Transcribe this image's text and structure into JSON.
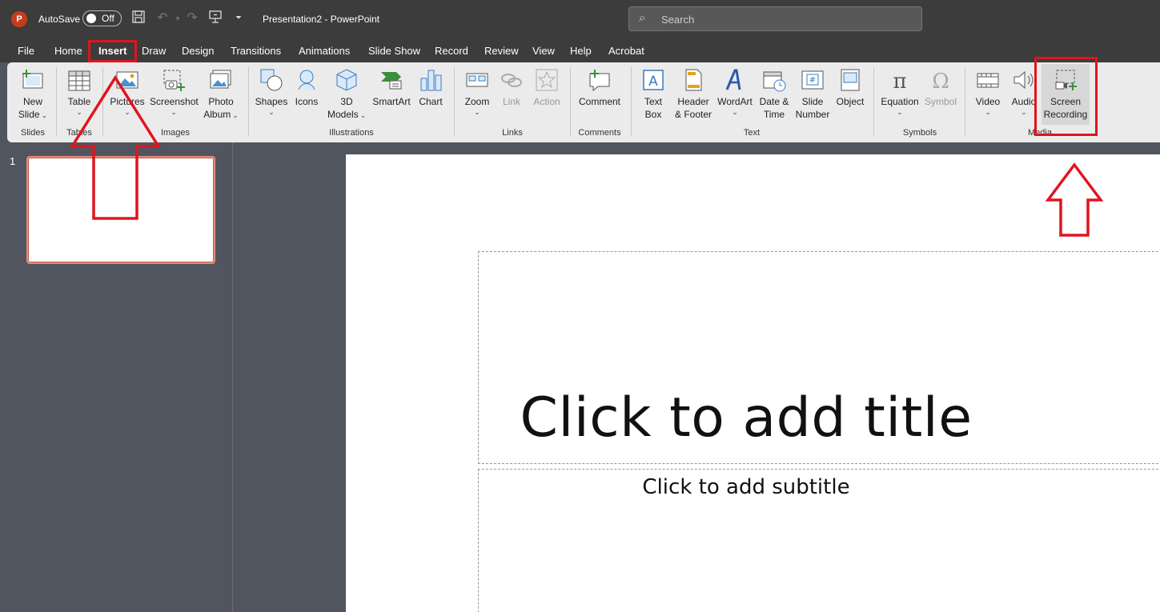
{
  "titlebar": {
    "logo_letter": "P",
    "autosave_label": "AutoSave",
    "autosave_state": "Off",
    "doc_title": "Presentation2  -  PowerPoint",
    "search_placeholder": "Search"
  },
  "menu": {
    "tabs": [
      "File",
      "Home",
      "Insert",
      "Draw",
      "Design",
      "Transitions",
      "Animations",
      "Slide Show",
      "Record",
      "Review",
      "View",
      "Help",
      "Acrobat"
    ],
    "active": "Insert"
  },
  "ribbon": {
    "buttons": {
      "new_slide": [
        "New",
        "Slide"
      ],
      "table": "Table",
      "pictures": "Pictures",
      "screenshot": "Screenshot",
      "photo_album": [
        "Photo",
        "Album"
      ],
      "shapes": "Shapes",
      "icons": "Icons",
      "models_3d": [
        "3D",
        "Models"
      ],
      "smartart": "SmartArt",
      "chart": "Chart",
      "zoom": "Zoom",
      "link": "Link",
      "action": "Action",
      "comment": "Comment",
      "text_box": [
        "Text",
        "Box"
      ],
      "header_footer": [
        "Header",
        "& Footer"
      ],
      "wordart": "WordArt",
      "date_time": [
        "Date &",
        "Time"
      ],
      "slide_number": [
        "Slide",
        "Number"
      ],
      "object": "Object",
      "equation": "Equation",
      "symbol": "Symbol",
      "video": "Video",
      "audio": "Audio",
      "screen_recording": [
        "Screen",
        "Recording"
      ]
    },
    "groups": {
      "slides": "Slides",
      "tables": "Tables",
      "images": "Images",
      "illustrations": "Illustrations",
      "links": "Links",
      "comments": "Comments",
      "text": "Text",
      "symbols": "Symbols",
      "media": "Media"
    }
  },
  "thumbnails": {
    "slide_number": "1"
  },
  "slide": {
    "title_placeholder": "Click to add title",
    "subtitle_placeholder": "Click to add subtitle"
  },
  "colors": {
    "annotation": "#e0141e",
    "accent": "#c43e1c"
  }
}
